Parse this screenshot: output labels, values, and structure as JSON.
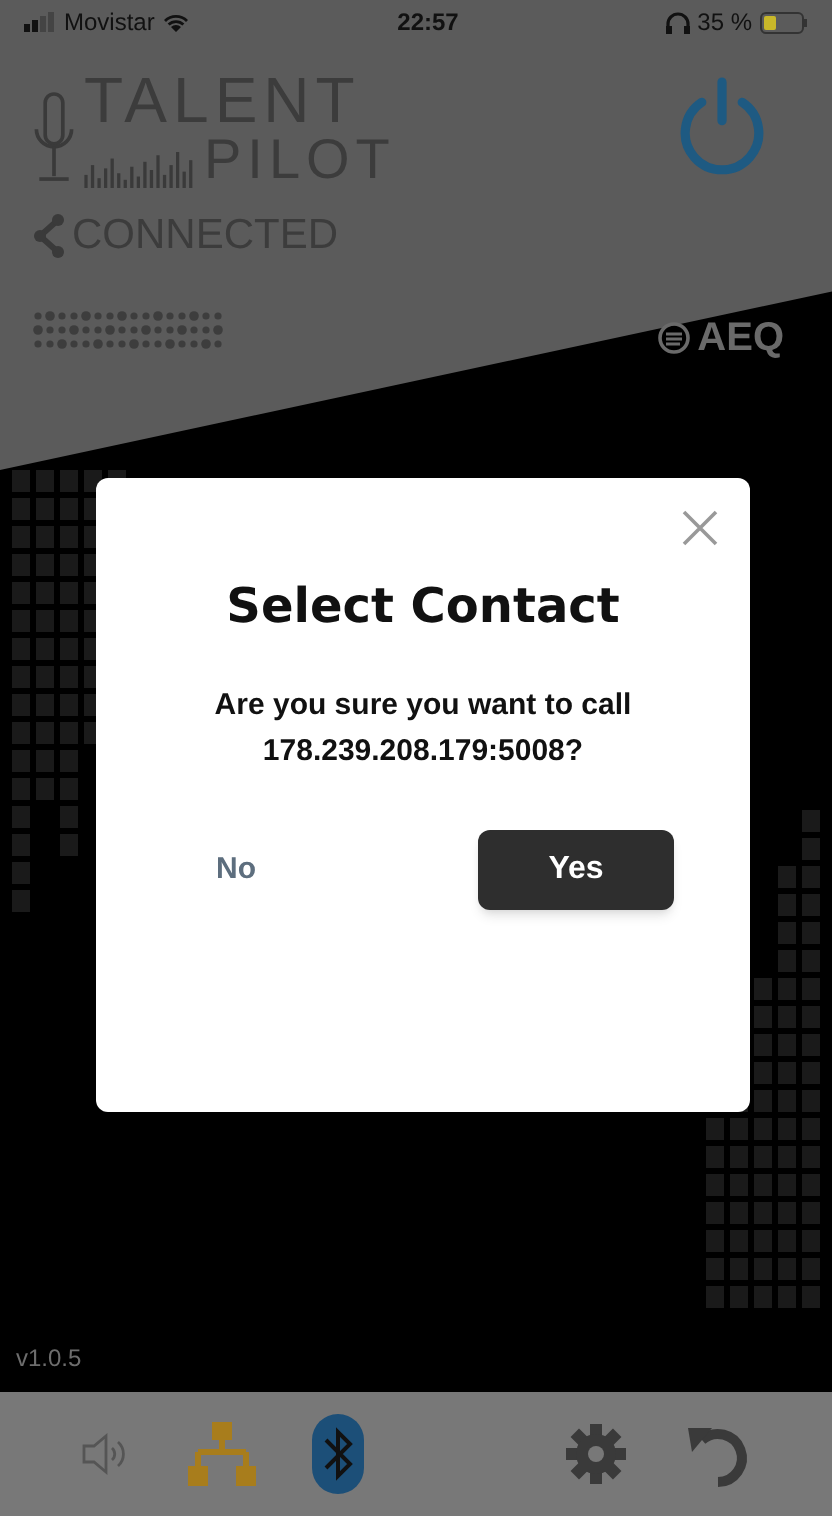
{
  "status_bar": {
    "carrier": "Movistar",
    "time": "22:57",
    "battery": "35 %"
  },
  "header": {
    "logo_top": "TALENT",
    "logo_bottom": "PILOT",
    "connection": "CONNECTED",
    "brand": "AEQ"
  },
  "version": "v1.0.5",
  "dialog": {
    "title": "Select Contact",
    "message": "Are you sure you want to call\n178.239.208.179:5008?",
    "buttons": [
      {
        "label": "No",
        "kind": "secondary"
      },
      {
        "label": "Yes",
        "kind": "primary"
      }
    ]
  }
}
